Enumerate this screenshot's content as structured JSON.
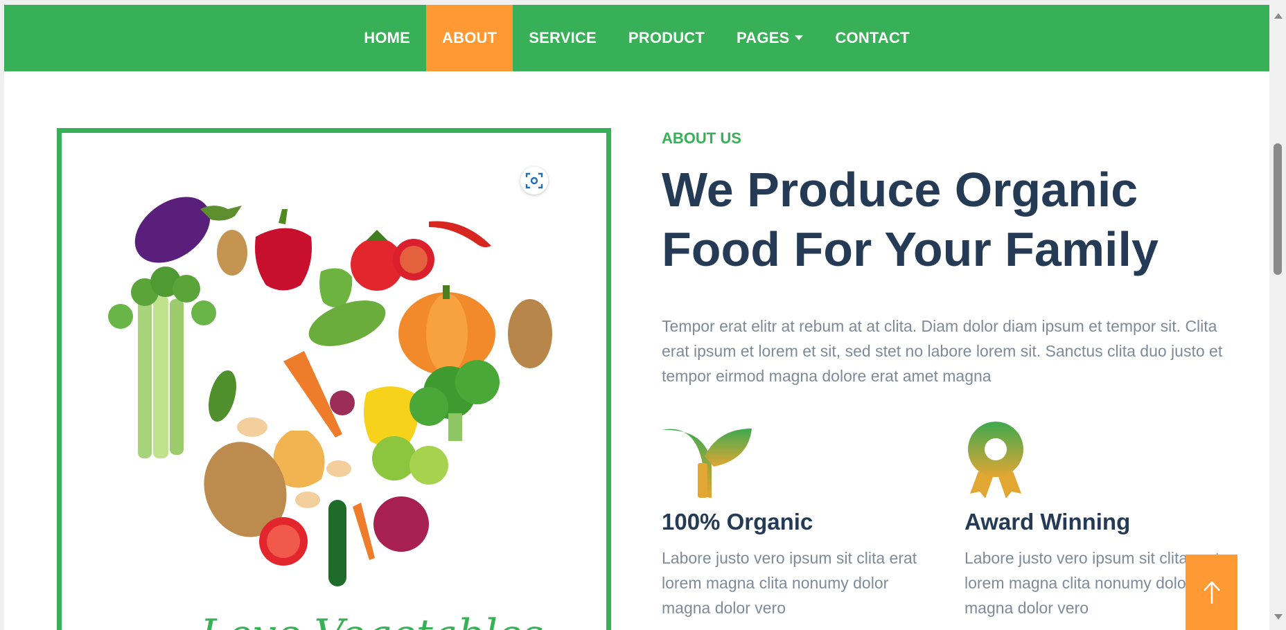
{
  "nav": {
    "items": [
      {
        "label": "HOME"
      },
      {
        "label": "ABOUT"
      },
      {
        "label": "SERVICE"
      },
      {
        "label": "PRODUCT"
      },
      {
        "label": "PAGES"
      },
      {
        "label": "CONTACT"
      }
    ],
    "active": "ABOUT"
  },
  "image": {
    "icon": "vegetable-heart-illustration",
    "caption_partial": "Love Vegetables"
  },
  "about": {
    "eyebrow": "ABOUT US",
    "headline_line1": "We Produce Organic",
    "headline_line2": "Food For Your Family",
    "description": "Tempor erat elitr at rebum at at clita. Diam dolor diam ipsum et tempor sit. Clita erat ipsum et lorem et sit, sed stet no labore lorem sit. Sanctus clita duo justo et tempor eirmod magna dolore erat amet magna"
  },
  "features": [
    {
      "icon": "sprout-icon",
      "title": "100% Organic",
      "text": "Labore justo vero ipsum sit clita erat lorem magna clita nonumy dolor magna dolor vero"
    },
    {
      "icon": "award-icon",
      "title": "Award Winning",
      "text": "Labore justo vero ipsum sit clita erat lorem magna clita nonumy dolor magna dolor vero"
    }
  ],
  "colors": {
    "primary": "#37b057",
    "accent": "#ff9933",
    "heading": "#243a55",
    "body_text": "#7f8a99"
  }
}
